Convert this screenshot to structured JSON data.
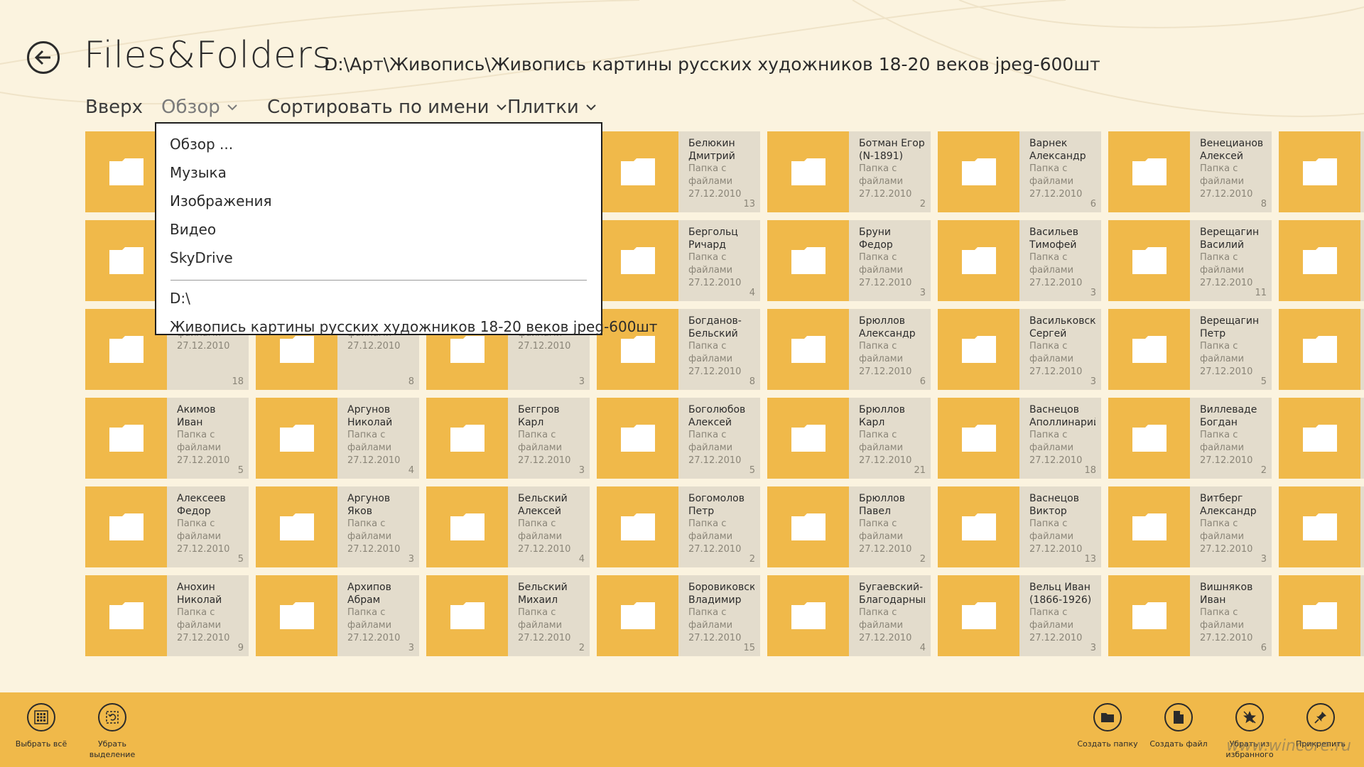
{
  "header": {
    "app_title": "Files&Folders",
    "path": "D:\\Арт\\Живопись\\Живопись картины русских художников 18-20 веков jpeg-600шт"
  },
  "commands": {
    "up": "Вверх",
    "browse": "Обзор",
    "sort": "Сортировать по имени",
    "view": "Плитки"
  },
  "dropdown": {
    "items_top": [
      "Обзор ...",
      "Музыка",
      "Изображения",
      "Видео",
      "SkyDrive"
    ],
    "items_bottom": [
      "D:\\",
      "Живопись картины русских художников 18-20 веков jpeg-600шт"
    ]
  },
  "tile_meta": {
    "type_line1": "Папка с",
    "type_line2": "файлами",
    "date": "27.12.2010"
  },
  "tiles": [
    {
      "name": "",
      "count": ""
    },
    {
      "name": "",
      "count": ""
    },
    {
      "name": "",
      "count": ""
    },
    {
      "name": "Белюкин Дмитрий",
      "count": "13"
    },
    {
      "name": "Ботман Егор (N-1891)",
      "count": "2"
    },
    {
      "name": "Варнек Александр",
      "count": "6"
    },
    {
      "name": "Венецианов Алексей",
      "count": "8"
    },
    {
      "name": "",
      "count": ""
    },
    {
      "name": "",
      "count": ""
    },
    {
      "name": "",
      "count": ""
    },
    {
      "name": "",
      "count": ""
    },
    {
      "name": "Бергольц Ричард",
      "count": "4"
    },
    {
      "name": "Бруни Федор Антонович",
      "count": "3"
    },
    {
      "name": "Васильев Тимофей",
      "count": "3"
    },
    {
      "name": "Верещагин Василий",
      "count": "11"
    },
    {
      "name": "",
      "count": ""
    },
    {
      "name": "",
      "count": "18"
    },
    {
      "name": "",
      "count": "8"
    },
    {
      "name": "",
      "count": "3"
    },
    {
      "name": "Богданов-Бельский",
      "count": "8"
    },
    {
      "name": "Брюллов Александр",
      "count": "6"
    },
    {
      "name": "Васильковский Сергей",
      "count": "3"
    },
    {
      "name": "Верещагин Петр",
      "count": "5"
    },
    {
      "name": "",
      "count": ""
    },
    {
      "name": "Акимов Иван Акимович",
      "count": "5"
    },
    {
      "name": "Аргунов Николай",
      "count": "4"
    },
    {
      "name": "Беггров Карл Петрович",
      "count": "3"
    },
    {
      "name": "Боголюбов Алексей",
      "count": "5"
    },
    {
      "name": "Брюллов Карл",
      "count": "21"
    },
    {
      "name": "Васнецов Аполлинарий",
      "count": "18"
    },
    {
      "name": "Виллеваде Богдан",
      "count": "2"
    },
    {
      "name": "",
      "count": ""
    },
    {
      "name": "Алексеев Федор",
      "count": "5"
    },
    {
      "name": "Аргунов Яков Иванович",
      "count": "3"
    },
    {
      "name": "Бельский Алексей",
      "count": "4"
    },
    {
      "name": "Богомолов Петр",
      "count": "2"
    },
    {
      "name": "Брюллов Павел",
      "count": "2"
    },
    {
      "name": "Васнецов Виктор",
      "count": "13"
    },
    {
      "name": "Витберг Александр",
      "count": "3"
    },
    {
      "name": "",
      "count": ""
    },
    {
      "name": "Анохин Николай",
      "count": "9"
    },
    {
      "name": "Архипов Абрам",
      "count": "3"
    },
    {
      "name": "Бельский Михаил",
      "count": "2"
    },
    {
      "name": "Боровиковский Владимир",
      "count": "15"
    },
    {
      "name": "Бугаевский-Благодарный",
      "count": "4"
    },
    {
      "name": "Вельц Иван (1866-1926)",
      "count": "3"
    },
    {
      "name": "Вишняков Иван",
      "count": "6"
    },
    {
      "name": "",
      "count": ""
    }
  ],
  "appbar": {
    "select_all": "Выбрать всё",
    "clear_selection_1": "Убрать",
    "clear_selection_2": "выделение",
    "create_folder": "Создать папку",
    "create_file": "Создать файл",
    "remove_fav_1": "Убрать из",
    "remove_fav_2": "избранного",
    "pin": "Прикрепить"
  },
  "watermark": "www.wincore.ru",
  "colors": {
    "accent": "#f0b94a",
    "background": "#fbf3df",
    "tile_info": "#e3dccc"
  }
}
